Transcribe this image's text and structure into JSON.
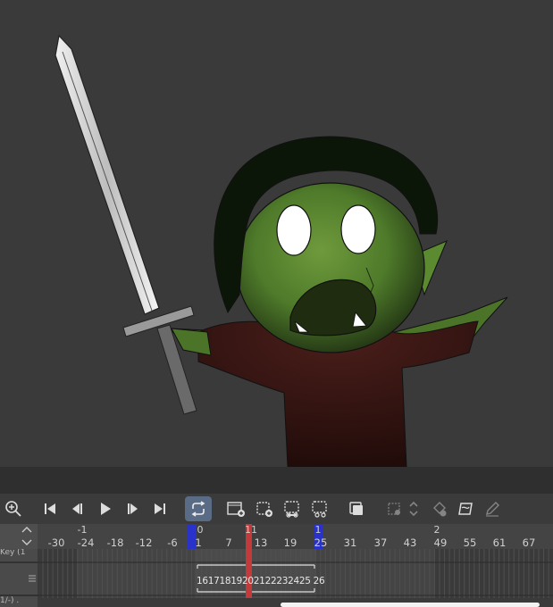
{
  "colors": {
    "canvas_bg": "#3a3a3a",
    "panel_bg": "#3b3b3b",
    "range_marker": "#2a33c9",
    "playhead": "#c23a3a",
    "active_button": "#5a6b86"
  },
  "toolbar": {
    "buttons": [
      {
        "name": "zoom-icon"
      },
      {
        "name": "first-frame-icon"
      },
      {
        "name": "previous-frame-icon"
      },
      {
        "name": "play-icon"
      },
      {
        "name": "next-frame-icon"
      },
      {
        "name": "last-frame-icon"
      },
      {
        "name": "loop-icon",
        "active": true
      },
      {
        "name": "new-animation-cel-icon"
      },
      {
        "name": "add-cel-icon"
      },
      {
        "name": "cel-link-icon"
      },
      {
        "name": "cel-unlink-icon"
      },
      {
        "name": "onion-skin-icon"
      },
      {
        "name": "transform-icon"
      },
      {
        "name": "up-down-chevron-icon"
      },
      {
        "name": "fill-icon"
      },
      {
        "name": "frame-icon"
      },
      {
        "name": "pen-icon"
      }
    ]
  },
  "ruler": {
    "upper_labels": [
      "-1",
      "0",
      "11",
      "1",
      "2"
    ],
    "frame_labels": [
      "-30",
      "-24",
      "-18",
      "-12",
      "-6",
      "1",
      "7",
      "13",
      "19",
      "25",
      "31",
      "37",
      "43",
      "49",
      "55",
      "61",
      "67"
    ]
  },
  "tracks": {
    "key_label": "Key (1",
    "bottom_label": "1/-) .",
    "cel_numbers": "16171819202122232425 26"
  }
}
